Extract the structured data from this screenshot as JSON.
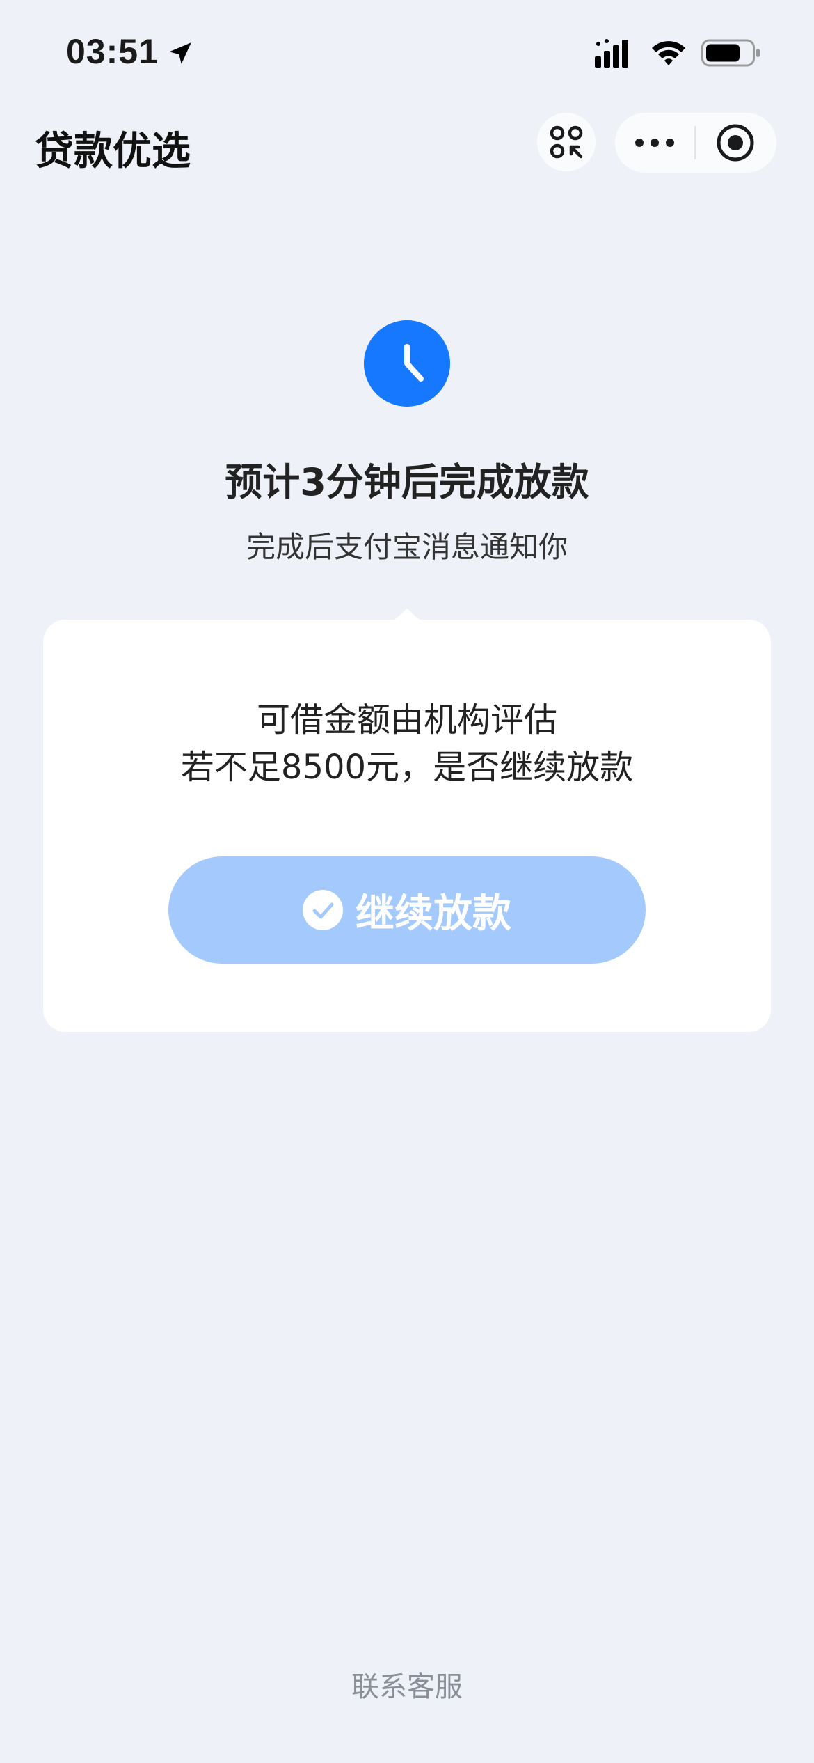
{
  "status_bar": {
    "time": "03:51"
  },
  "nav": {
    "title": "贷款优选"
  },
  "status": {
    "title": "预计3分钟后完成放款",
    "subtitle": "完成后支付宝消息通知你"
  },
  "card": {
    "line1": "可借金额由机构评估",
    "line2": "若不足8500元，是否继续放款",
    "button_label": "继续放款"
  },
  "footer": {
    "contact_label": "联系客服"
  },
  "colors": {
    "accent": "#1677ff",
    "button_disabled": "#a4c9fd",
    "background": "#eef2f8"
  },
  "icons": {
    "status_location": "location-arrow-icon",
    "status_signal": "cellular-signal-icon",
    "status_wifi": "wifi-icon",
    "status_battery": "battery-icon",
    "nav_shortcut": "mini-program-shortcut-icon",
    "nav_more": "more-dots-icon",
    "nav_close": "close-circle-icon",
    "status_clock": "clock-icon",
    "button_check": "check-circle-icon"
  }
}
